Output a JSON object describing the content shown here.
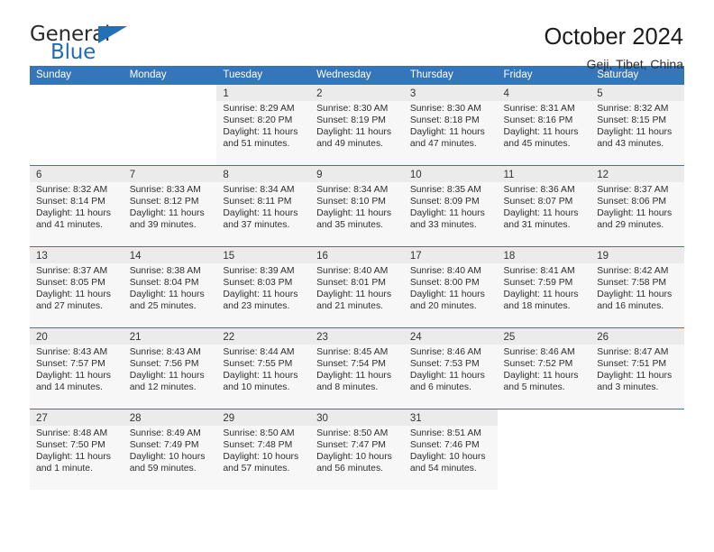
{
  "brand": {
    "name_top": "General",
    "name_bottom": "Blue",
    "accent_color": "#2071b9"
  },
  "header": {
    "title": "October 2024",
    "subtitle": "Geji, Tibet, China"
  },
  "calendar": {
    "header_bg": "#3576b8",
    "weekday_headers": [
      "Sunday",
      "Monday",
      "Tuesday",
      "Wednesday",
      "Thursday",
      "Friday",
      "Saturday"
    ],
    "weeks": [
      [
        {
          "day": "",
          "lines": []
        },
        {
          "day": "",
          "lines": []
        },
        {
          "day": "1",
          "lines": [
            "Sunrise: 8:29 AM",
            "Sunset: 8:20 PM",
            "Daylight: 11 hours",
            "and 51 minutes."
          ]
        },
        {
          "day": "2",
          "lines": [
            "Sunrise: 8:30 AM",
            "Sunset: 8:19 PM",
            "Daylight: 11 hours",
            "and 49 minutes."
          ]
        },
        {
          "day": "3",
          "lines": [
            "Sunrise: 8:30 AM",
            "Sunset: 8:18 PM",
            "Daylight: 11 hours",
            "and 47 minutes."
          ]
        },
        {
          "day": "4",
          "lines": [
            "Sunrise: 8:31 AM",
            "Sunset: 8:16 PM",
            "Daylight: 11 hours",
            "and 45 minutes."
          ]
        },
        {
          "day": "5",
          "lines": [
            "Sunrise: 8:32 AM",
            "Sunset: 8:15 PM",
            "Daylight: 11 hours",
            "and 43 minutes."
          ]
        }
      ],
      [
        {
          "day": "6",
          "lines": [
            "Sunrise: 8:32 AM",
            "Sunset: 8:14 PM",
            "Daylight: 11 hours",
            "and 41 minutes."
          ]
        },
        {
          "day": "7",
          "lines": [
            "Sunrise: 8:33 AM",
            "Sunset: 8:12 PM",
            "Daylight: 11 hours",
            "and 39 minutes."
          ]
        },
        {
          "day": "8",
          "lines": [
            "Sunrise: 8:34 AM",
            "Sunset: 8:11 PM",
            "Daylight: 11 hours",
            "and 37 minutes."
          ]
        },
        {
          "day": "9",
          "lines": [
            "Sunrise: 8:34 AM",
            "Sunset: 8:10 PM",
            "Daylight: 11 hours",
            "and 35 minutes."
          ]
        },
        {
          "day": "10",
          "lines": [
            "Sunrise: 8:35 AM",
            "Sunset: 8:09 PM",
            "Daylight: 11 hours",
            "and 33 minutes."
          ]
        },
        {
          "day": "11",
          "lines": [
            "Sunrise: 8:36 AM",
            "Sunset: 8:07 PM",
            "Daylight: 11 hours",
            "and 31 minutes."
          ]
        },
        {
          "day": "12",
          "lines": [
            "Sunrise: 8:37 AM",
            "Sunset: 8:06 PM",
            "Daylight: 11 hours",
            "and 29 minutes."
          ]
        }
      ],
      [
        {
          "day": "13",
          "lines": [
            "Sunrise: 8:37 AM",
            "Sunset: 8:05 PM",
            "Daylight: 11 hours",
            "and 27 minutes."
          ]
        },
        {
          "day": "14",
          "lines": [
            "Sunrise: 8:38 AM",
            "Sunset: 8:04 PM",
            "Daylight: 11 hours",
            "and 25 minutes."
          ]
        },
        {
          "day": "15",
          "lines": [
            "Sunrise: 8:39 AM",
            "Sunset: 8:03 PM",
            "Daylight: 11 hours",
            "and 23 minutes."
          ]
        },
        {
          "day": "16",
          "lines": [
            "Sunrise: 8:40 AM",
            "Sunset: 8:01 PM",
            "Daylight: 11 hours",
            "and 21 minutes."
          ]
        },
        {
          "day": "17",
          "lines": [
            "Sunrise: 8:40 AM",
            "Sunset: 8:00 PM",
            "Daylight: 11 hours",
            "and 20 minutes."
          ]
        },
        {
          "day": "18",
          "lines": [
            "Sunrise: 8:41 AM",
            "Sunset: 7:59 PM",
            "Daylight: 11 hours",
            "and 18 minutes."
          ]
        },
        {
          "day": "19",
          "lines": [
            "Sunrise: 8:42 AM",
            "Sunset: 7:58 PM",
            "Daylight: 11 hours",
            "and 16 minutes."
          ]
        }
      ],
      [
        {
          "day": "20",
          "lines": [
            "Sunrise: 8:43 AM",
            "Sunset: 7:57 PM",
            "Daylight: 11 hours",
            "and 14 minutes."
          ]
        },
        {
          "day": "21",
          "lines": [
            "Sunrise: 8:43 AM",
            "Sunset: 7:56 PM",
            "Daylight: 11 hours",
            "and 12 minutes."
          ]
        },
        {
          "day": "22",
          "lines": [
            "Sunrise: 8:44 AM",
            "Sunset: 7:55 PM",
            "Daylight: 11 hours",
            "and 10 minutes."
          ]
        },
        {
          "day": "23",
          "lines": [
            "Sunrise: 8:45 AM",
            "Sunset: 7:54 PM",
            "Daylight: 11 hours",
            "and 8 minutes."
          ]
        },
        {
          "day": "24",
          "lines": [
            "Sunrise: 8:46 AM",
            "Sunset: 7:53 PM",
            "Daylight: 11 hours",
            "and 6 minutes."
          ]
        },
        {
          "day": "25",
          "lines": [
            "Sunrise: 8:46 AM",
            "Sunset: 7:52 PM",
            "Daylight: 11 hours",
            "and 5 minutes."
          ]
        },
        {
          "day": "26",
          "lines": [
            "Sunrise: 8:47 AM",
            "Sunset: 7:51 PM",
            "Daylight: 11 hours",
            "and 3 minutes."
          ]
        }
      ],
      [
        {
          "day": "27",
          "lines": [
            "Sunrise: 8:48 AM",
            "Sunset: 7:50 PM",
            "Daylight: 11 hours",
            "and 1 minute."
          ]
        },
        {
          "day": "28",
          "lines": [
            "Sunrise: 8:49 AM",
            "Sunset: 7:49 PM",
            "Daylight: 10 hours",
            "and 59 minutes."
          ]
        },
        {
          "day": "29",
          "lines": [
            "Sunrise: 8:50 AM",
            "Sunset: 7:48 PM",
            "Daylight: 10 hours",
            "and 57 minutes."
          ]
        },
        {
          "day": "30",
          "lines": [
            "Sunrise: 8:50 AM",
            "Sunset: 7:47 PM",
            "Daylight: 10 hours",
            "and 56 minutes."
          ]
        },
        {
          "day": "31",
          "lines": [
            "Sunrise: 8:51 AM",
            "Sunset: 7:46 PM",
            "Daylight: 10 hours",
            "and 54 minutes."
          ]
        },
        {
          "day": "",
          "lines": []
        },
        {
          "day": "",
          "lines": []
        }
      ]
    ]
  }
}
